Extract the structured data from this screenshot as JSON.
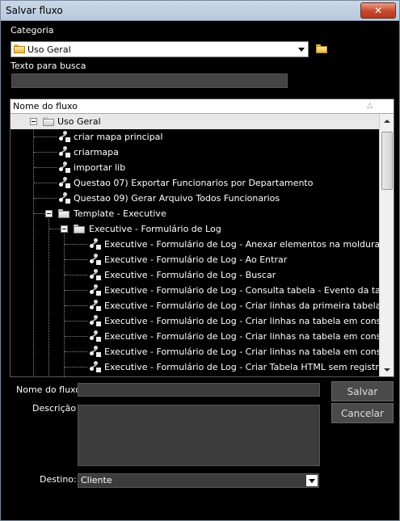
{
  "window": {
    "title": "Salvar fluxo",
    "close_label": "✕"
  },
  "categoria": {
    "label": "Categoria",
    "selected": "Uso Geral"
  },
  "busca": {
    "label": "Texto para busca",
    "value": ""
  },
  "tree": {
    "header": "Nome do fluxo",
    "sort_indicator": "△",
    "root": "Uso Geral",
    "items": [
      "criar mapa principal",
      "criarmapa",
      "importar lib",
      "Questao 07) Exportar Funcionarios por Departamento",
      "Questao 09) Gerar Arquivo Todos Funcionarios"
    ],
    "template_folder": "Template - Executive",
    "log_folder": "Executive - Formulário de Log",
    "log_items": [
      "Executive - Formulário de Log - Anexar elementos na moldura do topo",
      "Executive - Formulário de Log - Ao Entrar",
      "Executive - Formulário de Log - Buscar",
      "Executive - Formulário de Log - Consulta tabela - Evento da tabela",
      "Executive - Formulário de Log - Criar linhas da primeira tabela",
      "Executive - Formulário de Log - Criar linhas na tabela em consulta de al",
      "Executive - Formulário de Log - Criar linhas na tabela em consulta de e:",
      "Executive - Formulário de Log - Criar linhas na tabela em consulta de in",
      "Executive - Formulário de Log - Criar Tabela HTML sem registros"
    ]
  },
  "form": {
    "name_label": "Nome do fluxo",
    "name_value": "",
    "desc_label": "Descrição",
    "desc_value": "",
    "dest_label": "Destino:",
    "dest_value": "Cliente"
  },
  "buttons": {
    "save": "Salvar",
    "cancel": "Cancelar"
  }
}
